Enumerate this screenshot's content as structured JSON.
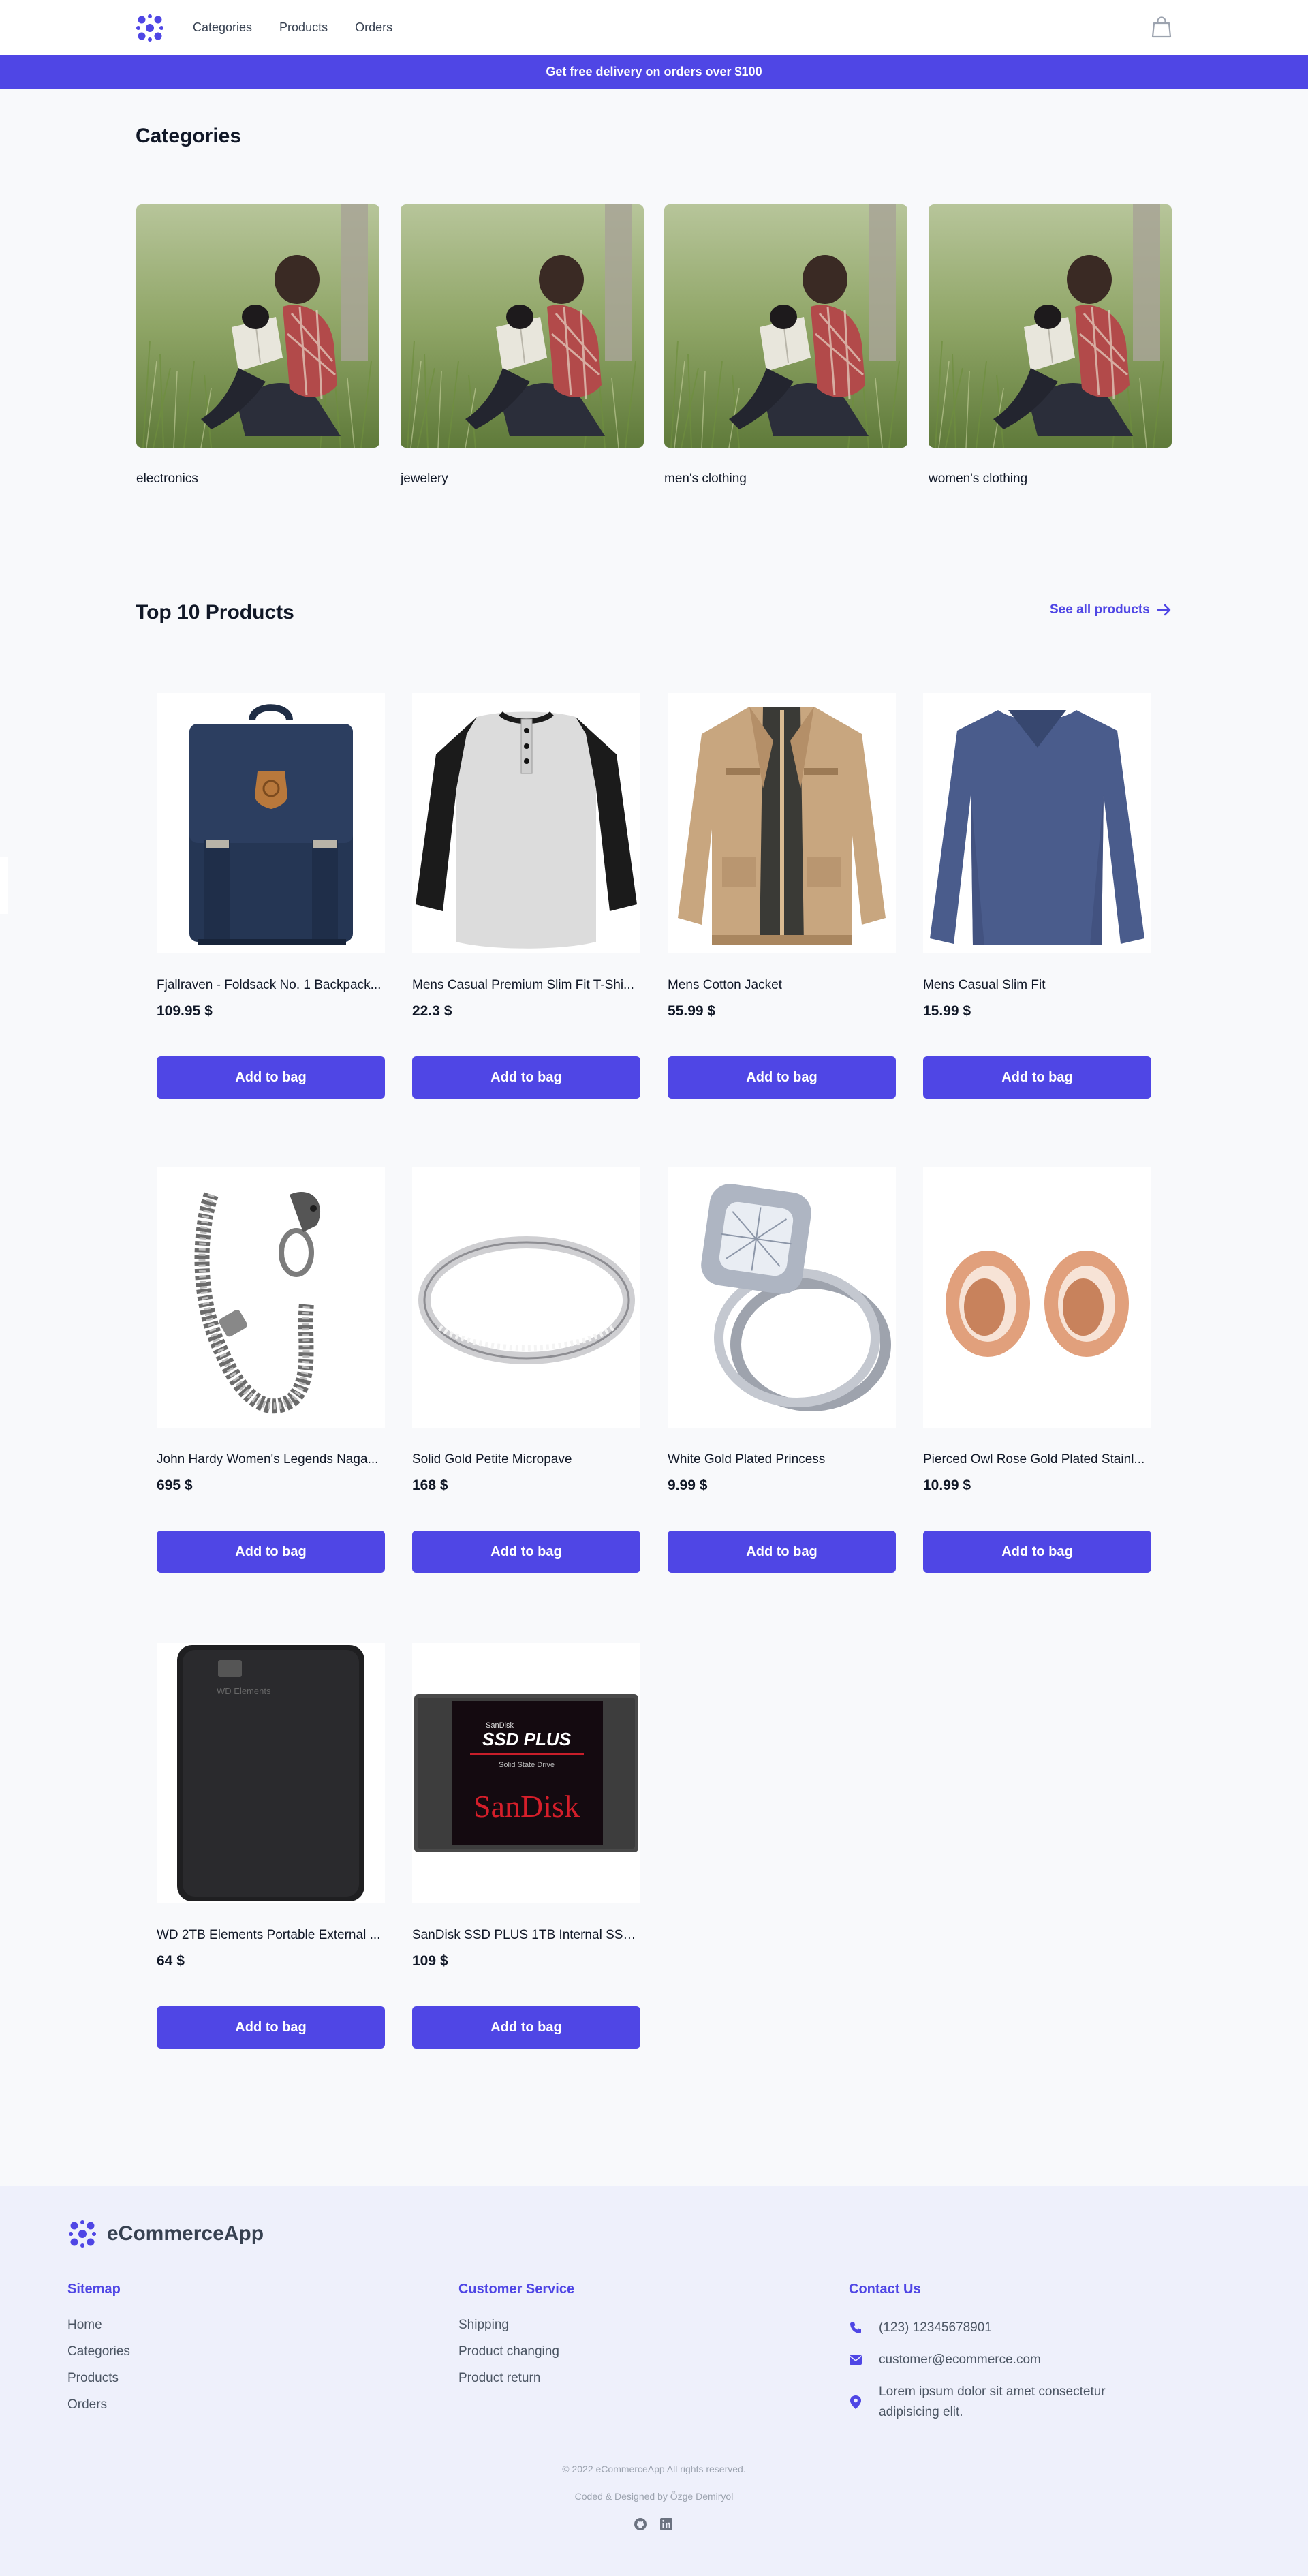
{
  "nav": {
    "links": [
      "Categories",
      "Products",
      "Orders"
    ],
    "logo_icon": "cluster-logo-icon",
    "bag_icon": "shopping-bag-icon"
  },
  "banner": {
    "text": "Get free delivery on orders over $100"
  },
  "categories": {
    "title": "Categories",
    "items": [
      {
        "label": "electronics"
      },
      {
        "label": "jewelery"
      },
      {
        "label": "men's clothing"
      },
      {
        "label": "women's clothing"
      }
    ]
  },
  "products": {
    "title": "Top 10 Products",
    "see_all": "See all products",
    "button_label": "Add to bag",
    "items": [
      {
        "name": "Fjallraven - Foldsack No. 1 Backpack...",
        "price": "109.95 $",
        "image": "backpack"
      },
      {
        "name": "Mens Casual Premium Slim Fit T-Shi...",
        "price": "22.3 $",
        "image": "raglan-tshirt"
      },
      {
        "name": "Mens Cotton Jacket",
        "price": "55.99 $",
        "image": "jacket"
      },
      {
        "name": "Mens Casual Slim Fit",
        "price": "15.99 $",
        "image": "longsleeve"
      },
      {
        "name": "John Hardy Women's Legends Naga...",
        "price": "695 $",
        "image": "chain-bracelet"
      },
      {
        "name": "Solid Gold Petite Micropave",
        "price": "168 $",
        "image": "pave-ring"
      },
      {
        "name": "White Gold Plated Princess",
        "price": "9.99 $",
        "image": "diamond-ring"
      },
      {
        "name": "Pierced Owl Rose Gold Plated Stainl...",
        "price": "10.99 $",
        "image": "rose-gold-plugs"
      },
      {
        "name": "WD 2TB Elements Portable External ...",
        "price": "64 $",
        "image": "hard-drive",
        "device_text": "WD Elements"
      },
      {
        "name": "SanDisk SSD PLUS 1TB Internal SSD ...",
        "price": "109 $",
        "image": "ssd",
        "device_text": {
          "small": "SanDisk",
          "big": "SSD PLUS",
          "sub": "Solid State Drive",
          "brand": "SanDisk"
        }
      }
    ]
  },
  "footer": {
    "brand": "eCommerceApp",
    "sitemap": {
      "title": "Sitemap",
      "links": [
        "Home",
        "Categories",
        "Products",
        "Orders"
      ]
    },
    "service": {
      "title": "Customer Service",
      "links": [
        "Shipping",
        "Product changing",
        "Product return"
      ]
    },
    "contact": {
      "title": "Contact Us",
      "phone": "(123) 12345678901",
      "email": "customer@ecommerce.com",
      "address_line1": "Lorem ipsum dolor sit amet consectetur",
      "address_line2": "adipisicing elit."
    },
    "copyright": "© 2022 eCommerceApp All rights reserved.",
    "credit": "Coded & Designed by Özge Demiryol",
    "social_icons": [
      "github-icon",
      "linkedin-icon"
    ]
  },
  "colors": {
    "accent": "#4f46e5",
    "footer_bg": "#eef0fb",
    "page_bg": "#f8f9fb"
  }
}
